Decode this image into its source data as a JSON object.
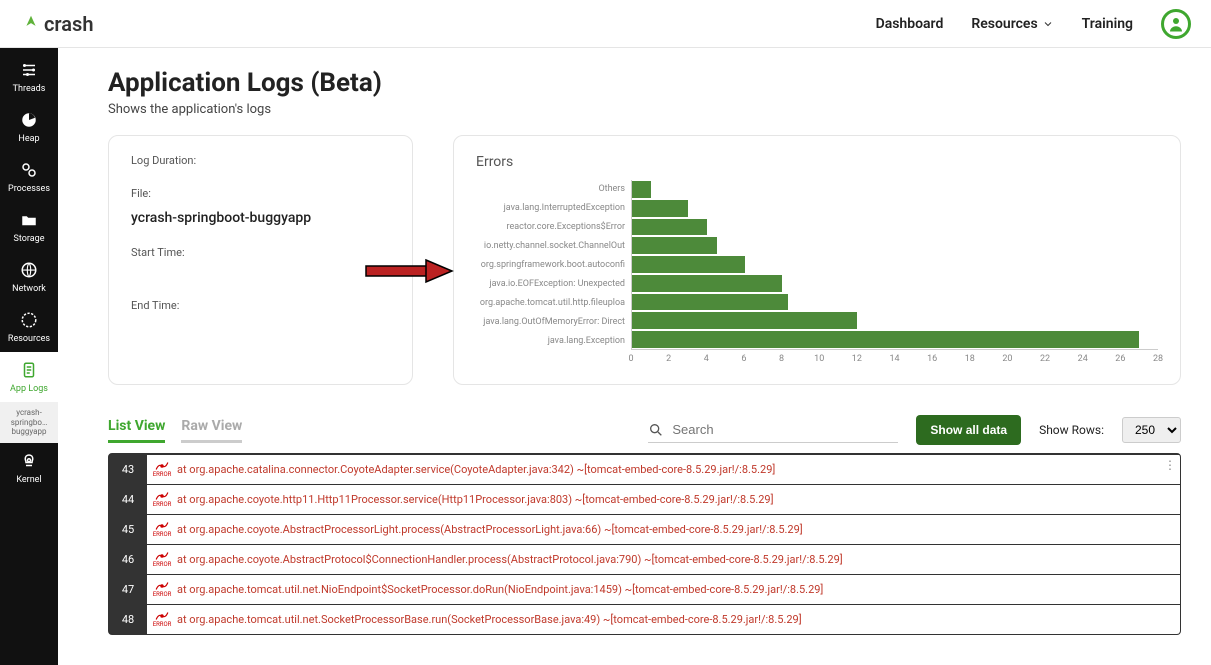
{
  "brand": "crash",
  "topnav": {
    "dashboard": "Dashboard",
    "resources": "Resources",
    "training": "Training"
  },
  "sidebar": {
    "threads": "Threads",
    "heap": "Heap",
    "processes": "Processes",
    "storage": "Storage",
    "network": "Network",
    "resources": "Resources",
    "applogs": "App Logs",
    "sub": "ycrash-springbo… buggyapp",
    "kernel": "Kernel"
  },
  "page": {
    "title": "Application Logs (Beta)",
    "subtitle": "Shows the application's logs"
  },
  "meta": {
    "duration_label": "Log Duration:",
    "file_label": "File:",
    "file_value": "ycrash-springboot-buggyapp",
    "start_label": "Start Time:",
    "end_label": "End Time:"
  },
  "chartTitle": "Errors",
  "chart_data": {
    "type": "bar",
    "orientation": "horizontal",
    "categories": [
      "Others",
      "java.lang.InterruptedException",
      "reactor.core.Exceptions$Error",
      "io.netty.channel.socket.ChannelOut",
      "org.springframework.boot.autoconfi",
      "java.io.EOFException: Unexpected",
      "org.apache.tomcat.util.http.fileuploa",
      "java.lang.OutOfMemoryError: Direct",
      "java.lang.Exception"
    ],
    "values": [
      1,
      3,
      4,
      4.5,
      6,
      8,
      8.3,
      12,
      27
    ],
    "xlabel": "",
    "ylabel": "",
    "xlim": [
      0,
      28
    ],
    "xticks": [
      0,
      2,
      4,
      6,
      8,
      10,
      12,
      14,
      16,
      18,
      20,
      22,
      24,
      26,
      28
    ]
  },
  "tabs": {
    "list": "List View",
    "raw": "Raw View"
  },
  "search": {
    "placeholder": "Search"
  },
  "showAll": "Show all data",
  "showRowsLabel": "Show Rows:",
  "rowsValue": "250",
  "logs": [
    {
      "num": "43",
      "text": "at org.apache.catalina.connector.CoyoteAdapter.service(CoyoteAdapter.java:342) ~[tomcat-embed-core-8.5.29.jar!/:8.5.29]"
    },
    {
      "num": "44",
      "text": "at org.apache.coyote.http11.Http11Processor.service(Http11Processor.java:803) ~[tomcat-embed-core-8.5.29.jar!/:8.5.29]"
    },
    {
      "num": "45",
      "text": "at org.apache.coyote.AbstractProcessorLight.process(AbstractProcessorLight.java:66) ~[tomcat-embed-core-8.5.29.jar!/:8.5.29]"
    },
    {
      "num": "46",
      "text": "at org.apache.coyote.AbstractProtocol$ConnectionHandler.process(AbstractProtocol.java:790) ~[tomcat-embed-core-8.5.29.jar!/:8.5.29]"
    },
    {
      "num": "47",
      "text": "at org.apache.tomcat.util.net.NioEndpoint$SocketProcessor.doRun(NioEndpoint.java:1459) ~[tomcat-embed-core-8.5.29.jar!/:8.5.29]"
    },
    {
      "num": "48",
      "text": "at org.apache.tomcat.util.net.SocketProcessorBase.run(SocketProcessorBase.java:49) ~[tomcat-embed-core-8.5.29.jar!/:8.5.29]"
    }
  ]
}
